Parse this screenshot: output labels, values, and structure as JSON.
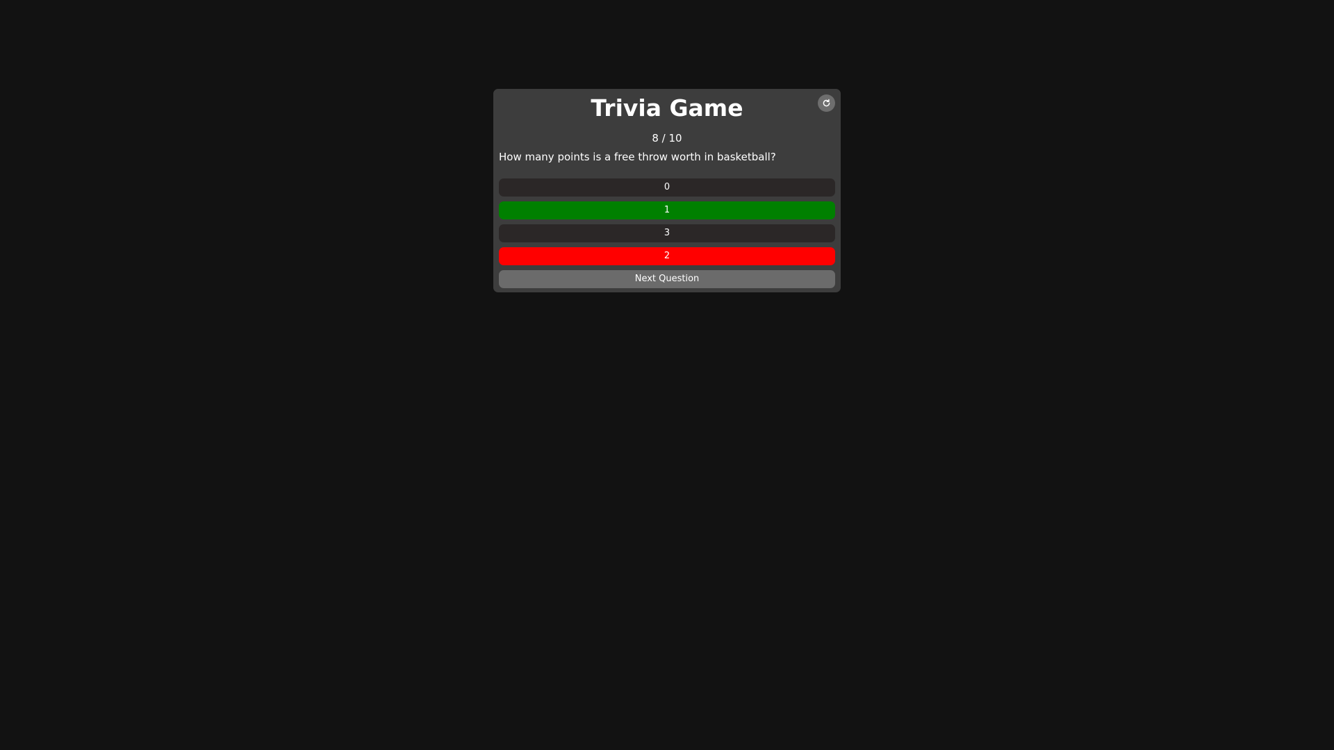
{
  "game": {
    "title": "Trivia Game",
    "progress": "8 / 10",
    "question": "How many points is a free throw worth in basketball?",
    "reset_icon": "refresh-icon"
  },
  "answers": [
    {
      "label": "0",
      "state": "neutral"
    },
    {
      "label": "1",
      "state": "correct"
    },
    {
      "label": "3",
      "state": "neutral"
    },
    {
      "label": "2",
      "state": "wrong"
    }
  ],
  "next_button": {
    "label": "Next Question"
  },
  "colors": {
    "background": "#121212",
    "panel": "#3d3d3d",
    "answer_neutral": "#2b2727",
    "answer_correct": "#008000",
    "answer_wrong": "#ff0000",
    "next_button": "#6b6b6b"
  }
}
